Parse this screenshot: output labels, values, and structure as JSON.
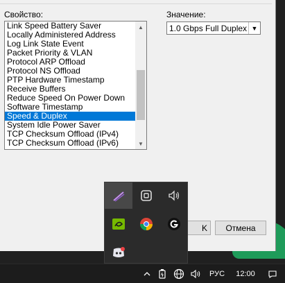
{
  "dialog": {
    "top_fragment": "свойство:",
    "property_label": "Свойство:",
    "value_label": "Значение:",
    "properties": [
      "Link Speed Battery Saver",
      "Locally Administered Address",
      "Log Link State Event",
      "Packet Priority & VLAN",
      "Protocol ARP Offload",
      "Protocol NS Offload",
      "PTP Hardware Timestamp",
      "Receive Buffers",
      "Reduce Speed On Power Down",
      "Software Timestamp",
      "Speed & Duplex",
      "System Idle Power Saver",
      "TCP Checksum Offload (IPv4)",
      "TCP Checksum Offload (IPv6)"
    ],
    "selected_index": 10,
    "value_selected": "1.0 Gbps Full Duplex",
    "ok_label": "K",
    "cancel_label": "Отмена"
  },
  "tray_flyout": {
    "icons": [
      "pen-icon",
      "phone-link-icon",
      "speaker-icon",
      "nvidia-icon",
      "chrome-icon",
      "logitech-g-icon",
      "discord-icon"
    ]
  },
  "taskbar": {
    "language": "РУС",
    "clock": "12:00"
  }
}
